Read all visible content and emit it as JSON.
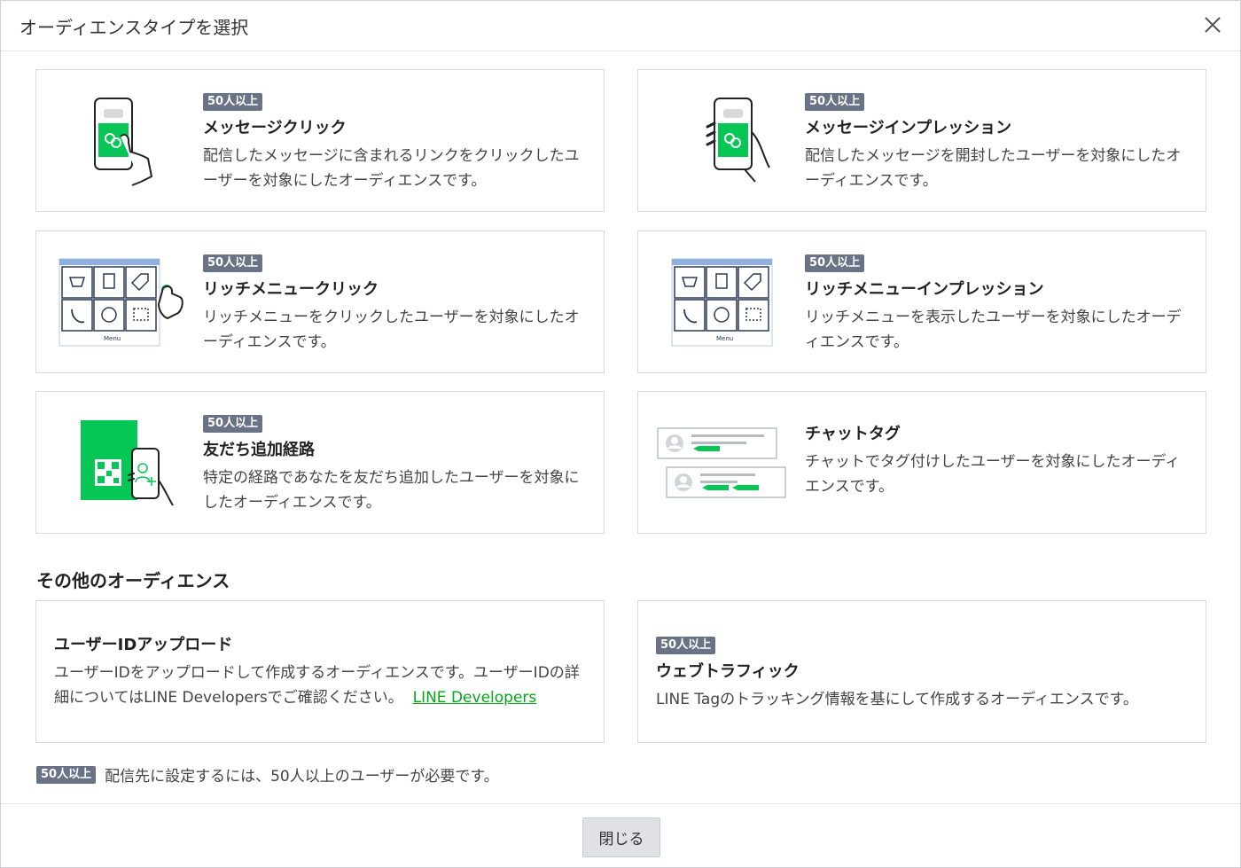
{
  "dialog": {
    "title": "オーディエンスタイプを選択",
    "close_icon": "close-icon"
  },
  "badge_label": "50人以上",
  "colors": {
    "badge": "#6a7386",
    "brand_green": "#06c755",
    "link": "#06a718"
  },
  "cards": [
    {
      "badge": "50人以上",
      "title": "メッセージクリック",
      "desc": "配信したメッセージに含まれるリンクをクリックしたユーザーを対象にしたオーディエンスです。",
      "icon": "phone-tap-link-icon"
    },
    {
      "badge": "50人以上",
      "title": "メッセージインプレッション",
      "desc": "配信したメッセージを開封したユーザーを対象にしたオーディエンスです。",
      "icon": "phone-hold-link-icon"
    },
    {
      "badge": "50人以上",
      "title": "リッチメニュークリック",
      "desc": "リッチメニューをクリックしたユーザーを対象にしたオーディエンスです。",
      "icon": "richmenu-tap-icon"
    },
    {
      "badge": "50人以上",
      "title": "リッチメニューインプレッション",
      "desc": "リッチメニューを表示したユーザーを対象にしたオーディエンスです。",
      "icon": "richmenu-icon"
    },
    {
      "badge": "50人以上",
      "title": "友だち追加経路",
      "desc": "特定の経路であなたを友だち追加したユーザーを対象にしたオーディエンスです。",
      "icon": "qr-add-friend-icon"
    },
    {
      "title": "チャットタグ",
      "desc": "チャットでタグ付けしたユーザーを対象にしたオーディエンスです。",
      "icon": "chat-tag-icon"
    }
  ],
  "richmenu_label": "Menu",
  "other_section": {
    "title": "その他のオーディエンス",
    "upload": {
      "title": "ユーザーIDアップロード",
      "desc": "ユーザーIDをアップロードして作成するオーディエンスです。ユーザーIDの詳細についてはLINE Developersでご確認ください。",
      "link": "LINE Developers"
    },
    "web": {
      "badge": "50人以上",
      "title": "ウェブトラフィック",
      "desc": "LINE Tagのトラッキング情報を基にして作成するオーディエンスです。"
    }
  },
  "footnote": {
    "badge": "50人以上",
    "text": "配信先に設定するには、50人以上のユーザーが必要です。"
  },
  "footer": {
    "close_label": "閉じる"
  }
}
